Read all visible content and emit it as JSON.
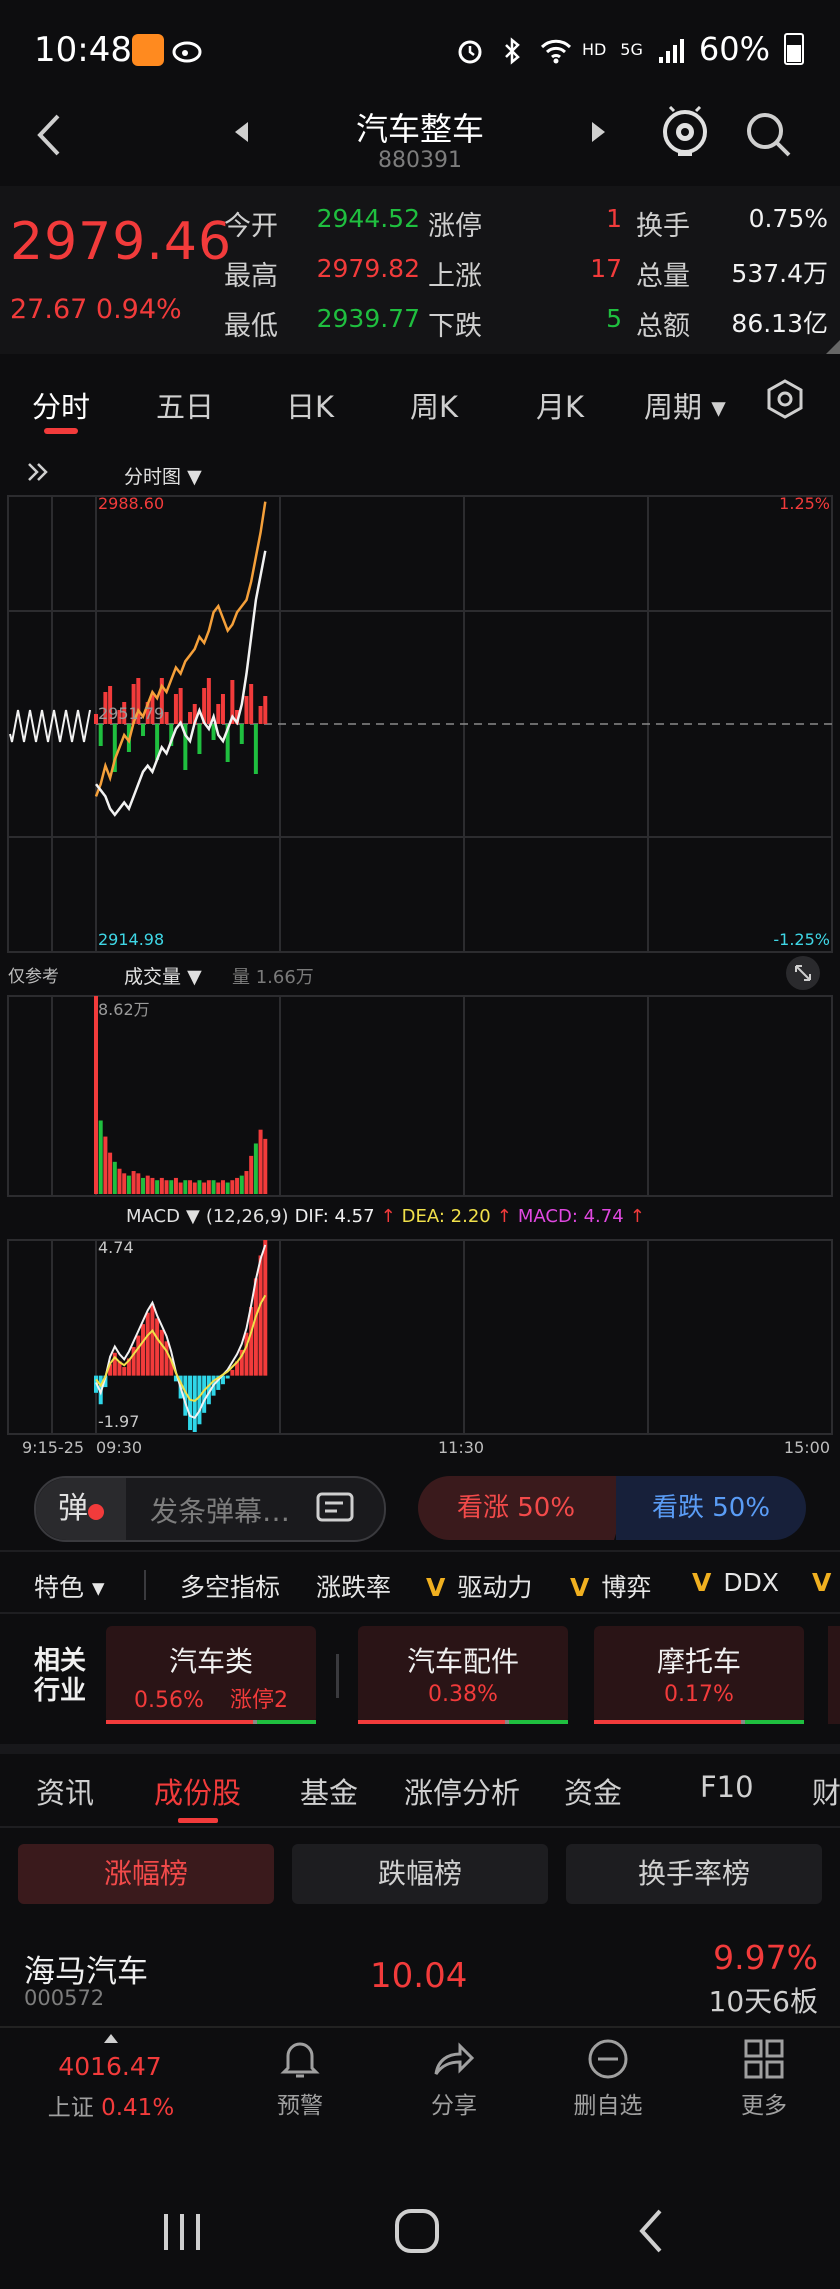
{
  "status_bar": {
    "time": "10:48",
    "network": "HD",
    "network_gen": "5G",
    "battery": "60%"
  },
  "header": {
    "title": "汽车整车",
    "code": "880391"
  },
  "quote": {
    "price": "2979.46",
    "change": "27.67",
    "change_pct": "0.94%",
    "rows": [
      {
        "l1": "今开",
        "v1": "2944.52",
        "c1": "#1fbf3f",
        "l2": "涨停",
        "v2": "1",
        "c2": "#f23b3b",
        "l3": "换手",
        "v3": "0.75%"
      },
      {
        "l1": "最高",
        "v1": "2979.82",
        "c1": "#f23b3b",
        "l2": "上涨",
        "v2": "17",
        "c2": "#f23b3b",
        "l3": "总量",
        "v3": "537.4万"
      },
      {
        "l1": "最低",
        "v1": "2939.77",
        "c1": "#1fbf3f",
        "l2": "下跌",
        "v2": "5",
        "c2": "#1fbf3f",
        "l3": "总额",
        "v3": "86.13亿"
      }
    ]
  },
  "tabs": [
    "分时",
    "五日",
    "日K",
    "周K",
    "月K",
    "周期"
  ],
  "chart": {
    "chart_type_label": "分时图",
    "price_high": "2988.60",
    "price_mid": "2951.79",
    "price_low": "2914.98",
    "pct_high": "1.25%",
    "pct_low": "-1.25%",
    "ref_label": "仅参考",
    "vol_label": "成交量",
    "vol_value": "量 1.66万",
    "vol_max": "8.62万",
    "macd_label": "MACD",
    "macd_params": "(12,26,9)",
    "dif": "DIF: 4.57",
    "dea": "DEA: 2.20",
    "macd_val": "MACD: 4.74",
    "macd_max": "4.74",
    "macd_min": "-1.97",
    "time_labels": [
      "9:15-25",
      "09:30",
      "11:30",
      "15:00"
    ]
  },
  "chart_data": {
    "type": "line",
    "x_range": [
      "09:30",
      "15:00"
    ],
    "ylim": [
      2914.98,
      2988.6
    ],
    "reference": 2951.79,
    "series": [],
    "price": [
      2940,
      2942,
      2945,
      2943,
      2946,
      2948,
      2950,
      2949,
      2952,
      2954,
      2953,
      2955,
      2957,
      2956,
      2958,
      2957,
      2959,
      2961,
      2960,
      2962,
      2963,
      2964,
      2966,
      2965,
      2967,
      2970,
      2971,
      2969,
      2967,
      2968,
      2970,
      2971,
      2972,
      2975,
      2979,
      2983,
      2988
    ],
    "avg": [
      2942,
      2941,
      2940,
      2938,
      2937,
      2938,
      2939,
      2938,
      2940,
      2942,
      2944,
      2945,
      2944,
      2946,
      2948,
      2947,
      2949,
      2951,
      2952,
      2950,
      2949,
      2952,
      2954,
      2952,
      2951,
      2953,
      2950,
      2949,
      2951,
      2953,
      2952,
      2955,
      2960,
      2966,
      2972,
      2976,
      2980
    ],
    "volume": [
      8.62,
      3.2,
      2.5,
      1.8,
      1.4,
      1.1,
      0.9,
      0.8,
      1.0,
      0.9,
      0.7,
      0.8,
      0.7,
      0.6,
      0.7,
      0.6,
      0.6,
      0.7,
      0.5,
      0.6,
      0.6,
      0.5,
      0.6,
      0.5,
      0.6,
      0.6,
      0.5,
      0.6,
      0.5,
      0.6,
      0.7,
      0.8,
      1.0,
      1.66,
      2.2,
      2.8,
      2.4
    ],
    "macd": [
      -0.6,
      -1.0,
      -0.4,
      0.4,
      0.8,
      0.5,
      0.3,
      0.6,
      1.0,
      1.4,
      1.8,
      2.2,
      2.5,
      2.0,
      1.6,
      1.2,
      0.6,
      -0.2,
      -0.8,
      -1.4,
      -1.9,
      -1.97,
      -1.7,
      -1.3,
      -1.0,
      -0.7,
      -0.5,
      -0.3,
      -0.1,
      0.2,
      0.5,
      0.9,
      1.5,
      2.4,
      3.4,
      4.2,
      4.74
    ]
  },
  "danmu": {
    "badge": "弹",
    "placeholder": "发条弹幕…",
    "bull": "看涨 50%",
    "bear": "看跌 50%"
  },
  "features": {
    "dropdown": "特色",
    "items": [
      "多空指标",
      "涨跌率",
      "驱动力",
      "博弈",
      "DDX"
    ],
    "v_mark": "V"
  },
  "industry": {
    "label_top": "相关",
    "label_bottom": "行业",
    "cards": [
      {
        "name": "汽车类",
        "pct": "0.56%",
        "extra": "涨停2"
      },
      {
        "name": "汽车配件",
        "pct": "0.38%",
        "extra": ""
      },
      {
        "name": "摩托车",
        "pct": "0.17%",
        "extra": ""
      }
    ]
  },
  "bottom_tabs": [
    "资讯",
    "成份股",
    "基金",
    "涨停分析",
    "资金",
    "F10",
    "财"
  ],
  "rank_buttons": [
    "涨幅榜",
    "跌幅榜",
    "换手率榜"
  ],
  "stock_row": {
    "name": "海马汽车",
    "code": "000572",
    "price": "10.04",
    "pct": "9.97%",
    "streak": "10天6板"
  },
  "nav": {
    "index_value": "4016.47",
    "index_name": "上证",
    "index_pct": "0.41%",
    "items": [
      "预警",
      "分享",
      "删自选",
      "更多"
    ]
  }
}
